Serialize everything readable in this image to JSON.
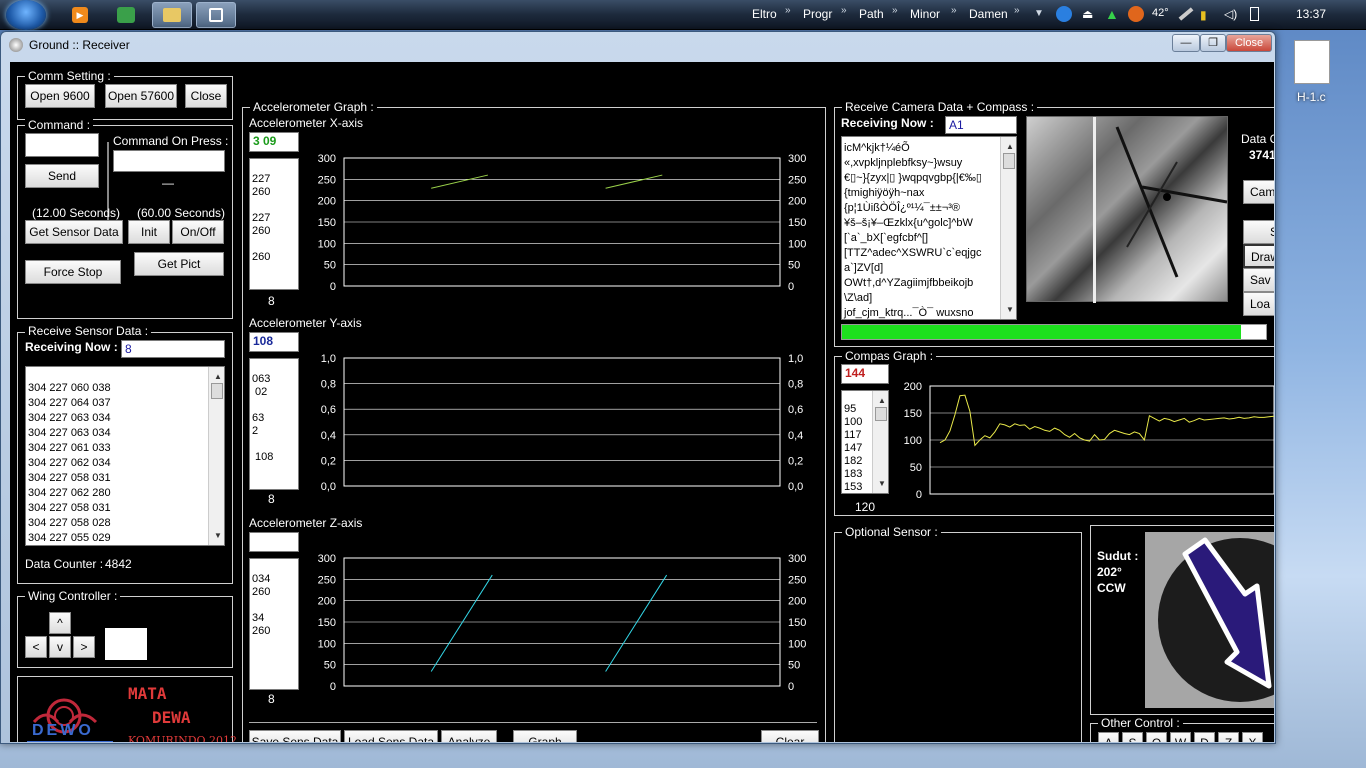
{
  "taskbar": {
    "links": [
      "Eltro",
      "Progr",
      "Path",
      "Minor",
      "Damen"
    ],
    "temp": "42°",
    "clock": "13:37"
  },
  "desktop": {
    "file_label": "H-1.c"
  },
  "window": {
    "title": "Ground :: Receiver",
    "min": "—",
    "max": "❐",
    "close": "Close"
  },
  "comm": {
    "title": "Comm Setting :",
    "open9600": "Open 9600",
    "open57600": "Open 57600",
    "close": "Close"
  },
  "command": {
    "title": "Command :",
    "send": "Send",
    "on_press_label": "Command On Press :",
    "dash": "—",
    "sec12": "(12.00 Seconds)",
    "sec60": "(60.00 Seconds)",
    "get_sensor": "Get Sensor Data",
    "init": "Init",
    "onoff": "On/Off",
    "force_stop": "Force Stop",
    "get_pict": "Get Pict"
  },
  "sensor": {
    "title": "Receive Sensor Data :",
    "receiving_label": "Receiving Now :",
    "receiving_value": "8",
    "rows": [
      "304 227 060 038",
      "304 227 064 037",
      "304 227 063 034",
      "304 227 063 034",
      "304 227 061 033",
      "304 227 062 034",
      "304 227 058 031",
      "304 227 062 280",
      "304 227 058 031",
      "304 227 058 028",
      "304 227 055 029"
    ],
    "counter_label": "Data Counter :",
    "counter_value": "4842"
  },
  "wing": {
    "title": "Wing Controller :",
    "up": "^",
    "left": "<",
    "down": "v",
    "right": ">"
  },
  "logo": {
    "line1": "MATA",
    "line2": "DEWA",
    "footer": "KOMURINDO 2012",
    "brand": "DEWO"
  },
  "accel": {
    "title": "Accelerometer Graph :",
    "x": {
      "label": "Accelerometer X-axis",
      "value": "3 09",
      "list": [
        "227",
        "260",
        "",
        "227",
        "260",
        "",
        "260"
      ],
      "count": "8"
    },
    "y": {
      "label": "Accelerometer Y-axis",
      "value": "108",
      "list": [
        "063",
        " 02",
        "",
        "63",
        "2",
        "",
        " 108"
      ],
      "count": "8"
    },
    "z": {
      "label": "Accelerometer Z-axis",
      "value": "",
      "list": [
        "034",
        "260",
        "",
        "34",
        "260"
      ],
      "count": "8"
    },
    "save": "Save Sens Data",
    "load": "Load Sens Data",
    "analyze": "Analyze",
    "graph": "Graph",
    "clear": "Clear"
  },
  "camera": {
    "title": "Receive Camera Data + Compass :",
    "receiving_label": "Receiving Now :",
    "receiving_value": "A1",
    "text": [
      "icM^kjk†¼éÕ",
      "«,xvpkljnplebfksy~}wsuy",
      "€▯~}{zyx|▯  }wqpqvgbp{|€‰▯",
      "{tmighiÿöÿh~nax",
      "{p¦1ÙißÒÖÎ¿º¹¼¯±±¬³®",
      "¥š–š¡¥–Œzklx{u^golc]^bW",
      "[`a`_bX[`egfcbf^[]",
      "[TTZ^adec^XSWRU`c`eqjgc",
      "a`]ZV[d]",
      "OWt†,d^YZagiimjfbbeikojb",
      "\\Z\\ad]",
      "jof_cjm_ktrq...¯Ò¯  wuxsno"
    ],
    "data_label": "Data C",
    "data_value": "3741",
    "side": [
      "Cam",
      "S",
      "Draw",
      "Sav",
      "Loa"
    ],
    "progress": 0.94
  },
  "compass": {
    "title": "Compas Graph :",
    "value": "144",
    "list": [
      "95",
      "100",
      "117",
      "147",
      "182",
      "183",
      "153"
    ],
    "count": "120",
    "sudut_label": "Sudut :",
    "sudut_value": "202°",
    "direction": "CCW"
  },
  "optional": {
    "title": "Optional Sensor :"
  },
  "other": {
    "title": "Other Control :",
    "keys": [
      "A",
      "S",
      "Q",
      "W",
      "D",
      "Z",
      "X"
    ]
  },
  "chart_data": [
    {
      "type": "line",
      "title": "Accelerometer X-axis",
      "ylim": [
        0,
        300
      ],
      "yticks": [
        0,
        50,
        100,
        150,
        200,
        250,
        300
      ],
      "segments": [
        [
          [
            0.2,
            229
          ],
          [
            0.33,
            260
          ]
        ],
        [
          [
            0.6,
            229
          ],
          [
            0.73,
            260
          ]
        ]
      ]
    },
    {
      "type": "line",
      "title": "Accelerometer Y-axis",
      "ylim": [
        0,
        1
      ],
      "yticks": [
        "0,0",
        "0,2",
        "0,4",
        "0,6",
        "0,8",
        "1,0"
      ],
      "segments": []
    },
    {
      "type": "line",
      "title": "Accelerometer Z-axis",
      "ylim": [
        0,
        300
      ],
      "yticks": [
        0,
        50,
        100,
        150,
        200,
        250,
        300
      ],
      "segments": [
        [
          [
            0.2,
            34
          ],
          [
            0.34,
            260
          ]
        ],
        [
          [
            0.6,
            34
          ],
          [
            0.74,
            260
          ]
        ]
      ]
    },
    {
      "type": "line",
      "title": "Compas Graph",
      "ylim": [
        0,
        200
      ],
      "yticks": [
        0,
        50,
        100,
        150,
        200
      ],
      "series": [
        {
          "values": [
            95,
            100,
            117,
            147,
            182,
            183,
            153,
            90,
            100,
            108,
            104,
            115,
            130,
            128,
            124,
            130,
            127,
            128,
            120,
            125,
            122,
            118,
            116,
            122,
            118,
            110,
            105,
            112,
            104,
            100,
            98,
            110,
            100,
            101,
            112,
            118,
            115,
            112,
            110,
            115,
            112,
            100,
            145,
            140,
            135,
            140,
            138,
            134,
            137,
            140,
            133,
            136,
            140,
            137,
            138,
            139,
            140,
            141,
            139,
            140,
            142,
            140,
            141,
            143,
            142,
            142,
            143,
            144
          ]
        }
      ]
    }
  ]
}
